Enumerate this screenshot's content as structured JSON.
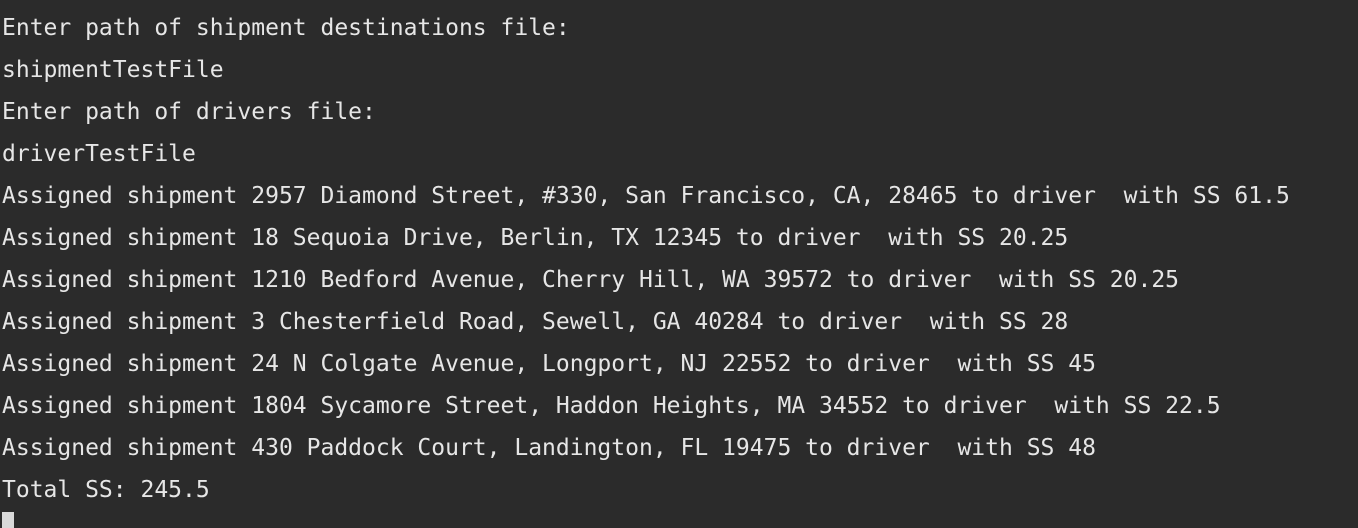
{
  "console": {
    "lines": [
      "Enter path of shipment destinations file:",
      "shipmentTestFile",
      "Enter path of drivers file:",
      "driverTestFile",
      "Assigned shipment 2957 Diamond Street, #330, San Francisco, CA, 28465 to driver  with SS 61.5",
      "Assigned shipment 18 Sequoia Drive, Berlin, TX 12345 to driver  with SS 20.25",
      "Assigned shipment 1210 Bedford Avenue, Cherry Hill, WA 39572 to driver  with SS 20.25",
      "Assigned shipment 3 Chesterfield Road, Sewell, GA 40284 to driver  with SS 28",
      "Assigned shipment 24 N Colgate Avenue, Longport, NJ 22552 to driver  with SS 45",
      "Assigned shipment 1804 Sycamore Street, Haddon Heights, MA 34552 to driver  with SS 22.5",
      "Assigned shipment 430 Paddock Court, Landington, FL 19475 to driver  with SS 48",
      "Total SS: 245.5"
    ]
  },
  "colors": {
    "background": "#2b2b2b",
    "text": "#e6e6e6",
    "cursor": "#d9d9d9"
  }
}
